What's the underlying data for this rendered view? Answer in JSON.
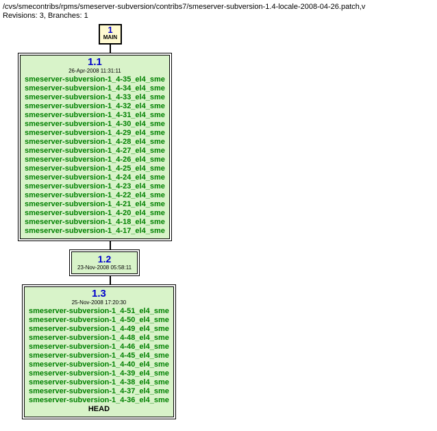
{
  "header": {
    "path": "/cvs/smecontribs/rpms/smeserver-subversion/contribs7/smeserver-subversion-1.4-locale-2008-04-26.patch,v",
    "revisions_line": "Revisions: 3, Branches: 1"
  },
  "root": {
    "number": "1",
    "label": "MAIN"
  },
  "nodes": [
    {
      "version": "1.1",
      "date": "26-Apr-2008 11:31:11",
      "tags": [
        "smeserver-subversion-1_4-35_el4_sme",
        "smeserver-subversion-1_4-34_el4_sme",
        "smeserver-subversion-1_4-33_el4_sme",
        "smeserver-subversion-1_4-32_el4_sme",
        "smeserver-subversion-1_4-31_el4_sme",
        "smeserver-subversion-1_4-30_el4_sme",
        "smeserver-subversion-1_4-29_el4_sme",
        "smeserver-subversion-1_4-28_el4_sme",
        "smeserver-subversion-1_4-27_el4_sme",
        "smeserver-subversion-1_4-26_el4_sme",
        "smeserver-subversion-1_4-25_el4_sme",
        "smeserver-subversion-1_4-24_el4_sme",
        "smeserver-subversion-1_4-23_el4_sme",
        "smeserver-subversion-1_4-22_el4_sme",
        "smeserver-subversion-1_4-21_el4_sme",
        "smeserver-subversion-1_4-20_el4_sme",
        "smeserver-subversion-1_4-18_el4_sme",
        "smeserver-subversion-1_4-17_el4_sme"
      ],
      "head": false
    },
    {
      "version": "1.2",
      "date": "23-Nov-2008 05:58:11",
      "tags": [],
      "head": false
    },
    {
      "version": "1.3",
      "date": "25-Nov-2008 17:20:30",
      "tags": [
        "smeserver-subversion-1_4-51_el4_sme",
        "smeserver-subversion-1_4-50_el4_sme",
        "smeserver-subversion-1_4-49_el4_sme",
        "smeserver-subversion-1_4-48_el4_sme",
        "smeserver-subversion-1_4-46_el4_sme",
        "smeserver-subversion-1_4-45_el4_sme",
        "smeserver-subversion-1_4-40_el4_sme",
        "smeserver-subversion-1_4-39_el4_sme",
        "smeserver-subversion-1_4-38_el4_sme",
        "smeserver-subversion-1_4-37_el4_sme",
        "smeserver-subversion-1_4-36_el4_sme"
      ],
      "head": true,
      "head_label": "HEAD"
    }
  ]
}
